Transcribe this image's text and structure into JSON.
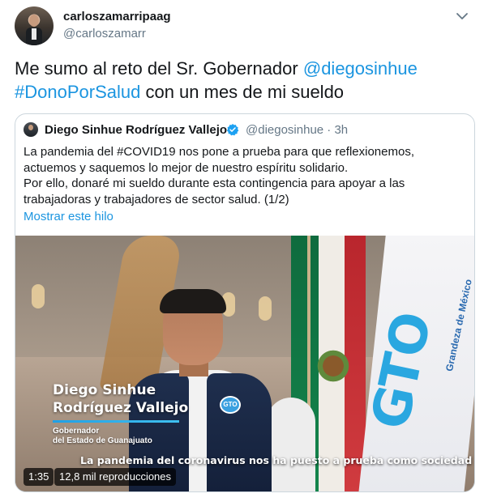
{
  "tweet": {
    "user_name": "carloszamarripaag",
    "user_handle": "@carloszamarr",
    "text_before": "Me sumo al reto del Sr. Gobernador ",
    "mention": "@diegosinhue",
    "hashtag": "#DonoPorSalud",
    "text_after": " con un mes de mi sueldo"
  },
  "quoted": {
    "name": "Diego Sinhue Rodríguez Vallejo",
    "meta": "@diegosinhue · 3h",
    "body": "La pandemia del #COVID19 nos pone a prueba para que reflexionemos, actuemos y saquemos lo mejor de nuestro espíritu solidario.\nPor ello, donaré mi sueldo durante esta contingencia para apoyar a las trabajadoras y trabajadores de sector salud. (1/2)",
    "show_thread": "Mostrar este hilo"
  },
  "video": {
    "name_line1": "Diego Sinhue",
    "name_line2": "Rodríguez Vallejo",
    "role_line1": "Gobernador",
    "role_line2": "del Estado de Guanajuato",
    "subtitle": "La pandemia del coronavirus nos ha puesto a prueba como sociedad",
    "duration": "1:35",
    "views": "12,8 mil reproducciones",
    "flag_logo": "GTO",
    "flag_tagline": "Grandeza de México",
    "vest_badge": "GTO"
  },
  "colors": {
    "link": "#1b95e0",
    "text": "#14171a",
    "muted": "#657786",
    "border": "#ccd6dd",
    "verified": "#1da1f2"
  },
  "icons": {
    "caret": "chevron-down-icon",
    "verified": "verified-badge-icon"
  }
}
